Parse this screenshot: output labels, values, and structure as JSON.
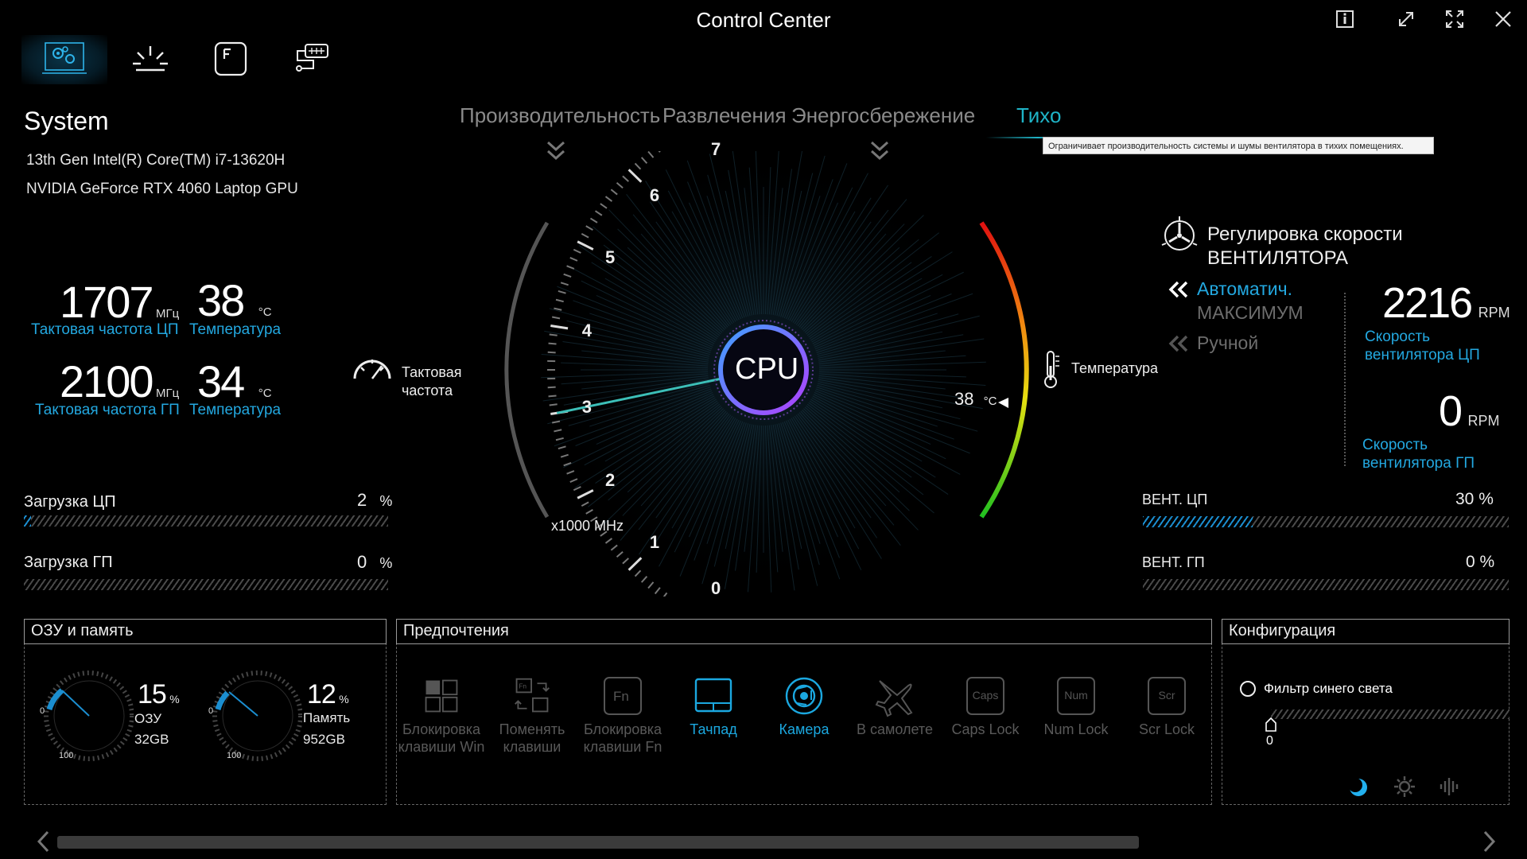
{
  "app": {
    "title": "Control Center"
  },
  "system": {
    "title": "System",
    "cpu_name": "13th Gen Intel(R) Core(TM) i7-13620H",
    "gpu_name": "NVIDIA GeForce RTX 4060 Laptop GPU"
  },
  "stats": {
    "cpu_clock": {
      "value": "1707",
      "unit": "МГц",
      "label": "Тактовая частота ЦП"
    },
    "cpu_temp": {
      "value": "38",
      "unit": "°C",
      "label": "Температура"
    },
    "gpu_clock": {
      "value": "2100",
      "unit": "МГц",
      "label": "Тактовая частота ГП"
    },
    "gpu_temp": {
      "value": "34",
      "unit": "°C",
      "label": "Температура"
    }
  },
  "load": {
    "cpu": {
      "label": "Загрузка ЦП",
      "value": "2",
      "unit": "%",
      "fraction": 0.02
    },
    "gpu": {
      "label": "Загрузка ГП",
      "value": "0",
      "unit": "%",
      "fraction": 0.0
    }
  },
  "modes": {
    "items": [
      "Производительность",
      "Развлечения",
      "Энергосбережение",
      "Тихо"
    ],
    "active": "Тихо",
    "tooltip": "Ограничивает производительность системы и шумы вентилятора в тихих помещениях."
  },
  "gauge": {
    "center_label": "CPU",
    "clock_label_line1": "Тактовая",
    "clock_label_line2": "частота",
    "scale_ticks": [
      "0",
      "1",
      "2",
      "3",
      "4",
      "5",
      "6",
      "7"
    ],
    "scale_unit": "x1000 MHz",
    "clock_value_ghz": 3.0,
    "temp_label": "Температура",
    "temp_value": "38",
    "temp_unit": "°C"
  },
  "fan": {
    "title_line1": "Регулировка скорости",
    "title_line2": "ВЕНТИЛЯТОРА",
    "mode_auto": "Автоматич.",
    "mode_max": "МАКСИМУМ",
    "mode_manual": "Ручной",
    "cpu_rpm": "2216",
    "gpu_rpm": "0",
    "rpm_unit": "RPM",
    "cpu_label_line1": "Скорость",
    "cpu_label_line2": "вентилятора ЦП",
    "gpu_label_line1": "Скорость",
    "gpu_label_line2": "вентилятора ГП",
    "cpu_fan_bar": {
      "label": "ВЕНТ. ЦП",
      "value": "30 %",
      "fraction": 0.3
    },
    "gpu_fan_bar": {
      "label": "ВЕНТ. ГП",
      "value": "0 %",
      "fraction": 0.0
    }
  },
  "memory": {
    "title": "ОЗУ и память",
    "ram": {
      "percent": "15",
      "pct_sign": "%",
      "label": "ОЗУ",
      "size": "32GB",
      "fraction": 0.15
    },
    "storage": {
      "percent": "12",
      "pct_sign": "%",
      "label": "Память",
      "size": "952GB",
      "fraction": 0.12
    },
    "dial_min": "0",
    "dial_max": "100"
  },
  "preferences": {
    "title": "Предпочтения",
    "items": [
      {
        "line1": "Блокировка",
        "line2": "клавиши Win",
        "icon": "windows-lock-icon",
        "on": false
      },
      {
        "line1": "Поменять",
        "line2": "клавиши",
        "icon": "swap-keys-icon",
        "on": false
      },
      {
        "line1": "Блокировка",
        "line2": "клавиши Fn",
        "icon": "fn-key-icon",
        "on": false
      },
      {
        "line1": "Тачпад",
        "line2": "",
        "icon": "touchpad-icon",
        "on": true
      },
      {
        "line1": "Камера",
        "line2": "",
        "icon": "camera-icon",
        "on": true
      },
      {
        "line1": "В самолете",
        "line2": "",
        "icon": "airplane-icon",
        "on": false
      },
      {
        "line1": "Caps Lock",
        "line2": "",
        "icon": "caps-lock-icon",
        "key": "Caps",
        "on": false
      },
      {
        "line1": "Num Lock",
        "line2": "",
        "icon": "num-lock-icon",
        "key": "Num",
        "on": false
      },
      {
        "line1": "Scr Lock",
        "line2": "",
        "icon": "scroll-lock-icon",
        "key": "Scr",
        "on": false
      }
    ]
  },
  "configuration": {
    "title": "Конфигурация",
    "blue_filter_label": "Фильтр синего света",
    "blue_filter_value": "0"
  },
  "colors": {
    "accent": "#23a8e0",
    "active_mode": "#1fb4c7"
  }
}
